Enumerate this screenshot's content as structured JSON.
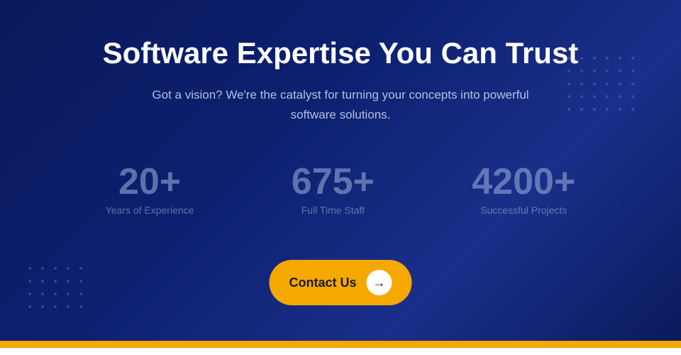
{
  "hero": {
    "heading": "Software Expertise You Can Trust",
    "subheading": "Got a vision? We're the catalyst for turning your concepts into powerful software solutions.",
    "stats": [
      {
        "number": "20+",
        "label": "Years of Experience"
      },
      {
        "number": "675+",
        "label": "Full Time Staff"
      },
      {
        "number": "4200+",
        "label": "Successful Projects"
      }
    ],
    "cta_label": "Contact Us",
    "arrow_icon": "→"
  },
  "bottom_bar": {
    "color": "#f5a800"
  },
  "dots": {
    "top_right_rows": 5,
    "top_right_cols": 6,
    "bottom_left_rows": 4,
    "bottom_left_cols": 5
  }
}
